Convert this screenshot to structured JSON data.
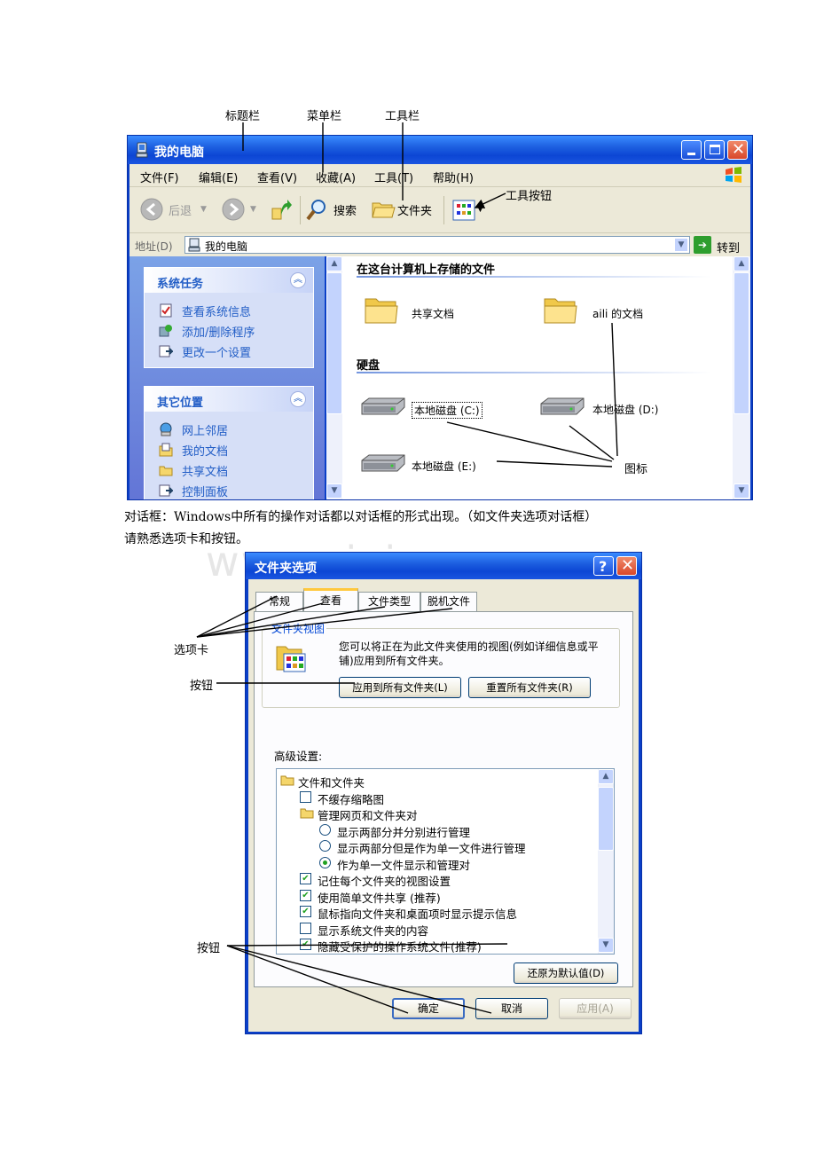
{
  "callouts": {
    "title_bar": "标题栏",
    "menu_bar": "菜单栏",
    "toolbar": "工具栏",
    "toolbar_button": "工具按钮",
    "icons": "图标",
    "tabs": "选项卡",
    "button1": "按钮",
    "button2": "按钮"
  },
  "explorer": {
    "title": "我的电脑",
    "menu": [
      "文件(F)",
      "编辑(E)",
      "查看(V)",
      "收藏(A)",
      "工具(T)",
      "帮助(H)"
    ],
    "toolbar": {
      "back": "后退",
      "search": "搜索",
      "folders": "文件夹"
    },
    "address_label": "地址(D)",
    "address_value": "我的电脑",
    "go": "转到",
    "system_tasks": {
      "title": "系统任务",
      "items": [
        "查看系统信息",
        "添加/删除程序",
        "更改一个设置"
      ]
    },
    "other_places": {
      "title": "其它位置",
      "items": [
        "网上邻居",
        "我的文档",
        "共享文档",
        "控制面板"
      ]
    },
    "group1": "在这台计算机上存储的文件",
    "folders": [
      "共享文档",
      "aili 的文档"
    ],
    "group2": "硬盘",
    "disks": [
      "本地磁盘 (C:)",
      "本地磁盘 (D:)",
      "本地磁盘 (E:)"
    ]
  },
  "body": {
    "line1": "对话框：Windows中所有的操作对话都以对话框的形式出现。（如文件夹选项对话框）",
    "line2_prefix": "请熟悉",
    "line2_tabs": "选项卡",
    "line2_and": "和",
    "line2_buttons": "按钮",
    "line2_end": "。",
    "watermark": "www.zixin.com.cn"
  },
  "dialog": {
    "title": "文件夹选项",
    "tabs": [
      "常规",
      "查看",
      "文件类型",
      "脱机文件"
    ],
    "group_label": "文件夹视图",
    "group_text": "您可以将正在为此文件夹使用的视图(例如详细信息或平铺)应用到所有文件夹。",
    "apply_all": "应用到所有文件夹(L)",
    "reset_all": "重置所有文件夹(R)",
    "advanced_label": "高级设置:",
    "advanced": [
      {
        "kind": "folder",
        "label": "文件和文件夹",
        "checked": false
      },
      {
        "kind": "checkbox",
        "label": "不缓存缩略图",
        "checked": false
      },
      {
        "kind": "folder",
        "label": "管理网页和文件夹对",
        "checked": false
      },
      {
        "kind": "radio",
        "label": "显示两部分并分别进行管理",
        "checked": false
      },
      {
        "kind": "radio",
        "label": "显示两部分但是作为单一文件进行管理",
        "checked": false
      },
      {
        "kind": "radio",
        "label": "作为单一文件显示和管理对",
        "checked": true
      },
      {
        "kind": "checkbox",
        "label": "记住每个文件夹的视图设置",
        "checked": true
      },
      {
        "kind": "checkbox",
        "label": "使用简单文件共享 (推荐)",
        "checked": true
      },
      {
        "kind": "checkbox",
        "label": "鼠标指向文件夹和桌面项时显示提示信息",
        "checked": true
      },
      {
        "kind": "checkbox",
        "label": "显示系统文件夹的内容",
        "checked": false
      },
      {
        "kind": "checkbox",
        "label": "隐藏受保护的操作系统文件(推荐)",
        "checked": true
      }
    ],
    "restore_defaults": "还原为默认值(D)",
    "ok": "确定",
    "cancel": "取消",
    "apply": "应用(A)"
  }
}
